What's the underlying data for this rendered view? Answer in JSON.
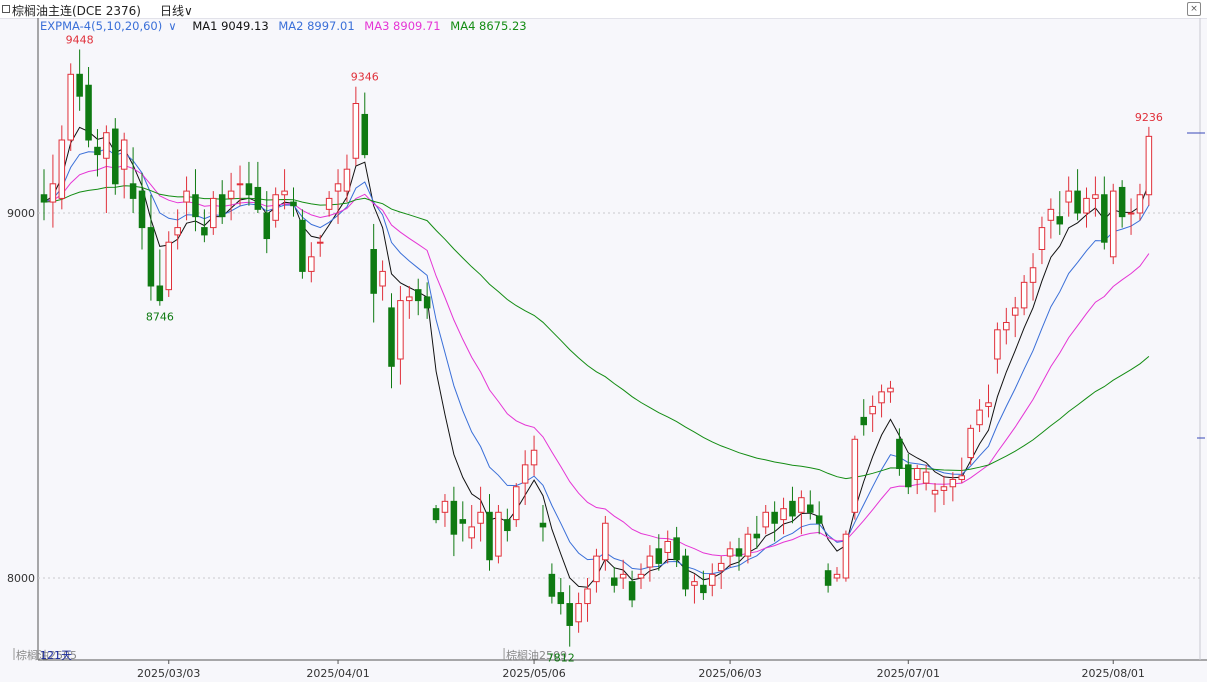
{
  "window": {
    "title": "棕榈油主连(DCE 2376)",
    "period": "日线",
    "period_arrow": "∨",
    "close_glyph": "×"
  },
  "legend": {
    "indicator": "EXPMA-4(5,10,20,60)",
    "indicator_arrow": "∨",
    "ma1": "MA1 9049.13",
    "ma2": "MA2 8997.01",
    "ma3": "MA3 8909.71",
    "ma4": "MA4 8675.23"
  },
  "colors": {
    "up": "#e0303a",
    "down": "#0f7a12",
    "ma1": "#111111",
    "ma2": "#3a6fd8",
    "ma3": "#e535d5",
    "ma4": "#138c13",
    "grid": "#c8c8cc",
    "axis": "#555555"
  },
  "chart_data": {
    "type": "candlestick",
    "ylim": [
      7600,
      9600
    ],
    "yticks": [
      8000,
      9000
    ],
    "bar_count_label": "121天",
    "contract_labels": [
      {
        "text": "棕榈油2505",
        "index": 0
      },
      {
        "text": "棕榈油2509",
        "index": 55
      }
    ],
    "xticks": [
      {
        "text": "2025/03/03",
        "index": 14
      },
      {
        "text": "2025/04/01",
        "index": 33
      },
      {
        "text": "2025/05/06",
        "index": 55
      },
      {
        "text": "2025/06/03",
        "index": 77
      },
      {
        "text": "2025/07/01",
        "index": 97
      },
      {
        "text": "2025/08/01",
        "index": 120
      }
    ],
    "annotations": [
      {
        "text": "9448",
        "index": 4,
        "value": 9448,
        "kind": "high"
      },
      {
        "text": "8746",
        "index": 13,
        "value": 8746,
        "kind": "low"
      },
      {
        "text": "9346",
        "index": 36,
        "value": 9346,
        "kind": "high"
      },
      {
        "text": "7812",
        "index": 58,
        "value": 7812,
        "kind": "low"
      },
      {
        "text": "9236",
        "index": 124,
        "value": 9236,
        "kind": "high"
      }
    ],
    "ohlc": [
      [
        9050,
        9120,
        8980,
        9030
      ],
      [
        9030,
        9160,
        8960,
        9080
      ],
      [
        9040,
        9240,
        9010,
        9200
      ],
      [
        9200,
        9410,
        9170,
        9380
      ],
      [
        9380,
        9448,
        9280,
        9320
      ],
      [
        9350,
        9400,
        9180,
        9200
      ],
      [
        9180,
        9230,
        9100,
        9160
      ],
      [
        9150,
        9240,
        9000,
        9220
      ],
      [
        9230,
        9260,
        9050,
        9080
      ],
      [
        9120,
        9220,
        9040,
        9200
      ],
      [
        9080,
        9180,
        9000,
        9040
      ],
      [
        9060,
        9110,
        8900,
        8960
      ],
      [
        8960,
        9050,
        8760,
        8800
      ],
      [
        8800,
        8900,
        8746,
        8760
      ],
      [
        8790,
        8950,
        8770,
        8920
      ],
      [
        8940,
        9010,
        8900,
        8960
      ],
      [
        9030,
        9100,
        8980,
        9060
      ],
      [
        9050,
        9120,
        8950,
        8990
      ],
      [
        8960,
        9010,
        8920,
        8940
      ],
      [
        8960,
        9060,
        8940,
        9040
      ],
      [
        9050,
        9090,
        8970,
        8990
      ],
      [
        9040,
        9110,
        8980,
        9060
      ],
      [
        9080,
        9130,
        9020,
        9080
      ],
      [
        9080,
        9140,
        9020,
        9050
      ],
      [
        9070,
        9140,
        9000,
        9010
      ],
      [
        9000,
        9060,
        8890,
        8930
      ],
      [
        8980,
        9070,
        8960,
        9050
      ],
      [
        9050,
        9120,
        9010,
        9060
      ],
      [
        9030,
        9070,
        8990,
        9020
      ],
      [
        8980,
        9010,
        8820,
        8840
      ],
      [
        8840,
        8920,
        8810,
        8880
      ],
      [
        8920,
        8940,
        8880,
        8920
      ],
      [
        9010,
        9060,
        8990,
        9040
      ],
      [
        9060,
        9120,
        8970,
        9080
      ],
      [
        9060,
        9160,
        9030,
        9120
      ],
      [
        9150,
        9346,
        9130,
        9300
      ],
      [
        9270,
        9330,
        9150,
        9160
      ],
      [
        8900,
        8970,
        8700,
        8780
      ],
      [
        8800,
        8870,
        8760,
        8840
      ],
      [
        8740,
        8780,
        8520,
        8580
      ],
      [
        8600,
        8800,
        8530,
        8760
      ],
      [
        8760,
        8800,
        8710,
        8770
      ],
      [
        8790,
        8820,
        8720,
        8760
      ],
      [
        8770,
        8810,
        8710,
        8740
      ],
      [
        8190,
        8200,
        8150,
        8160
      ],
      [
        8180,
        8230,
        8140,
        8210
      ],
      [
        8210,
        8250,
        8060,
        8120
      ],
      [
        8160,
        8210,
        8100,
        8150
      ],
      [
        8110,
        8200,
        8080,
        8140
      ],
      [
        8150,
        8250,
        8100,
        8180
      ],
      [
        8180,
        8230,
        8020,
        8050
      ],
      [
        8060,
        8200,
        8040,
        8180
      ],
      [
        8160,
        8190,
        8100,
        8130
      ],
      [
        8160,
        8260,
        8140,
        8250
      ],
      [
        8260,
        8350,
        8200,
        8310
      ],
      [
        8310,
        8390,
        8280,
        8350
      ],
      [
        8150,
        8200,
        8100,
        8140
      ],
      [
        8010,
        8040,
        7930,
        7950
      ],
      [
        7960,
        8000,
        7900,
        7930
      ],
      [
        7930,
        7980,
        7812,
        7870
      ],
      [
        7880,
        7960,
        7850,
        7930
      ],
      [
        7930,
        8000,
        7880,
        7970
      ],
      [
        7990,
        8080,
        7960,
        8060
      ],
      [
        8050,
        8170,
        8020,
        8150
      ],
      [
        8000,
        8030,
        7960,
        7980
      ],
      [
        8000,
        8050,
        7970,
        8010
      ],
      [
        7990,
        8020,
        7920,
        7940
      ],
      [
        8000,
        8040,
        7970,
        8010
      ],
      [
        8030,
        8090,
        7990,
        8060
      ],
      [
        8080,
        8120,
        8020,
        8040
      ],
      [
        8070,
        8130,
        8040,
        8100
      ],
      [
        8110,
        8140,
        8030,
        8050
      ],
      [
        8060,
        8080,
        7950,
        7970
      ],
      [
        7980,
        8010,
        7930,
        7990
      ],
      [
        7980,
        8020,
        7940,
        7960
      ],
      [
        7980,
        8040,
        7950,
        8010
      ],
      [
        8020,
        8060,
        7970,
        8040
      ],
      [
        8060,
        8100,
        8030,
        8080
      ],
      [
        8080,
        8110,
        8020,
        8060
      ],
      [
        8060,
        8140,
        8040,
        8120
      ],
      [
        8120,
        8170,
        8080,
        8110
      ],
      [
        8140,
        8200,
        8120,
        8180
      ],
      [
        8180,
        8210,
        8100,
        8150
      ],
      [
        8160,
        8220,
        8120,
        8190
      ],
      [
        8210,
        8250,
        8150,
        8170
      ],
      [
        8180,
        8240,
        8120,
        8220
      ],
      [
        8200,
        8240,
        8160,
        8180
      ],
      [
        8170,
        8210,
        8120,
        8150
      ],
      [
        8020,
        8040,
        7960,
        7980
      ],
      [
        8000,
        8030,
        7990,
        8010
      ],
      [
        8000,
        8130,
        7990,
        8120
      ],
      [
        8180,
        8390,
        8160,
        8380
      ],
      [
        8440,
        8490,
        8390,
        8420
      ],
      [
        8450,
        8500,
        8400,
        8470
      ],
      [
        8480,
        8530,
        8440,
        8510
      ],
      [
        8510,
        8540,
        8480,
        8520
      ],
      [
        8380,
        8410,
        8280,
        8300
      ],
      [
        8310,
        8340,
        8230,
        8250
      ],
      [
        8270,
        8310,
        8230,
        8300
      ],
      [
        8260,
        8310,
        8240,
        8290
      ],
      [
        8230,
        8260,
        8180,
        8240
      ],
      [
        8240,
        8280,
        8200,
        8250
      ],
      [
        8250,
        8290,
        8210,
        8270
      ],
      [
        8270,
        8330,
        8260,
        8280
      ],
      [
        8330,
        8420,
        8310,
        8410
      ],
      [
        8420,
        8490,
        8400,
        8460
      ],
      [
        8470,
        8530,
        8440,
        8480
      ],
      [
        8600,
        8700,
        8560,
        8680
      ],
      [
        8680,
        8740,
        8640,
        8700
      ],
      [
        8720,
        8770,
        8660,
        8740
      ],
      [
        8740,
        8830,
        8720,
        8810
      ],
      [
        8810,
        8890,
        8760,
        8850
      ],
      [
        8900,
        8990,
        8860,
        8960
      ],
      [
        8980,
        9040,
        8930,
        9010
      ],
      [
        8990,
        9060,
        8940,
        8970
      ],
      [
        9030,
        9100,
        8990,
        9060
      ],
      [
        9060,
        9120,
        8980,
        9000
      ],
      [
        9000,
        9070,
        8960,
        9040
      ],
      [
        9040,
        9100,
        8990,
        9050
      ],
      [
        9050,
        9100,
        8900,
        8920
      ],
      [
        8880,
        9080,
        8860,
        9060
      ],
      [
        9070,
        9090,
        8960,
        8990
      ],
      [
        9000,
        9040,
        8940,
        9000
      ],
      [
        9000,
        9080,
        8980,
        9050
      ],
      [
        9050,
        9236,
        9020,
        9210
      ]
    ]
  }
}
